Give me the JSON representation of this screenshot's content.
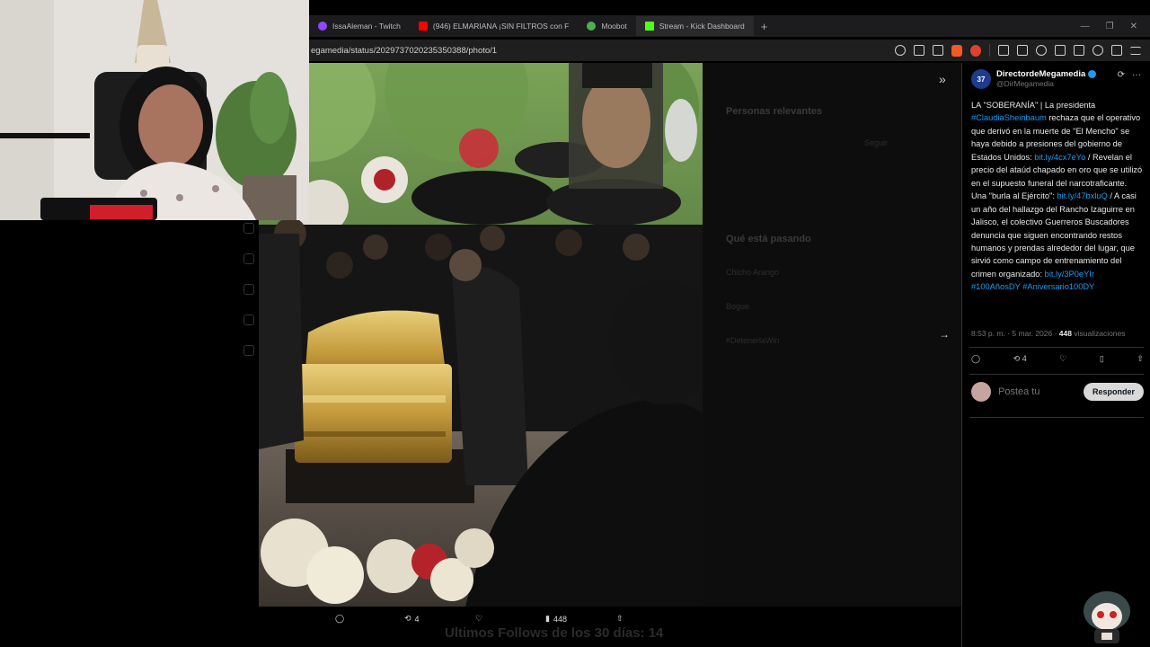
{
  "tabs": [
    {
      "label": "IssaAleman - Twitch",
      "color": "#9146ff"
    },
    {
      "label": "(946) ELMARIANA ¡SIN FILTROS con F",
      "color": "#ff0000"
    },
    {
      "label": "Moobot",
      "color": "#4caf50"
    },
    {
      "label": "Stream - Kick Dashboard",
      "color": "#53fc18"
    }
  ],
  "url": "egamedia/status/2029737020235350388/photo/1",
  "post": {
    "display_name": "DirectordeMegamedia",
    "handle": "@DirMegamedia",
    "avatar_text": "37",
    "text_parts": [
      {
        "t": "LA \"SOBERANÍA\" | La presidenta ",
        "link": false
      },
      {
        "t": "#ClaudiaSheinbaum",
        "link": true
      },
      {
        "t": " rechaza que el operativo que derivó en la muerte de \"El Mencho\" se haya debido a presiones del gobierno de Estados Unidos: ",
        "link": false
      },
      {
        "t": "bit.ly/4cx7eYo",
        "link": true
      },
      {
        "t": " / Revelan el precio del ataúd chapado en oro que se utilizó en el supuesto funeral del narcotraficante. Una \"burla al Ejército\": ",
        "link": false
      },
      {
        "t": "bit.ly/47bxluQ",
        "link": true
      },
      {
        "t": " / A casi un año del hallazgo del Rancho Izaguirre en Jalisco, el colectivo Guerreros Buscadores denuncia que siguen encontrando restos humanos y prendas alrededor del lugar, que sirvió como campo de entrenamiento del crimen organizado: ",
        "link": false
      },
      {
        "t": "bit.ly/3P0eYIr",
        "link": true
      },
      {
        "t": " ",
        "link": false
      },
      {
        "t": "#100AñosDY",
        "link": true
      },
      {
        "t": " ",
        "link": false
      },
      {
        "t": "#Aniversario100DY",
        "link": true
      }
    ],
    "time": "8:53 p. m. · 5 mar. 2026 · ",
    "views_count": "448",
    "views_label": " visualizaciones",
    "retweets": "4",
    "reply_placeholder": "Postea tu",
    "reply_button": "Responder"
  },
  "viewer_bar": {
    "retweets": "4",
    "views": "448"
  },
  "background_ghost": {
    "relevant": "Personas relevantes",
    "follow": "Seguir",
    "happening": "Qué está pasando",
    "trend1": "Chicho Arango",
    "trend2": "Bogue",
    "trend3": "#DetenerlaWin"
  },
  "overlay_caption": "Ultimos Follows de los 30 días: 14"
}
